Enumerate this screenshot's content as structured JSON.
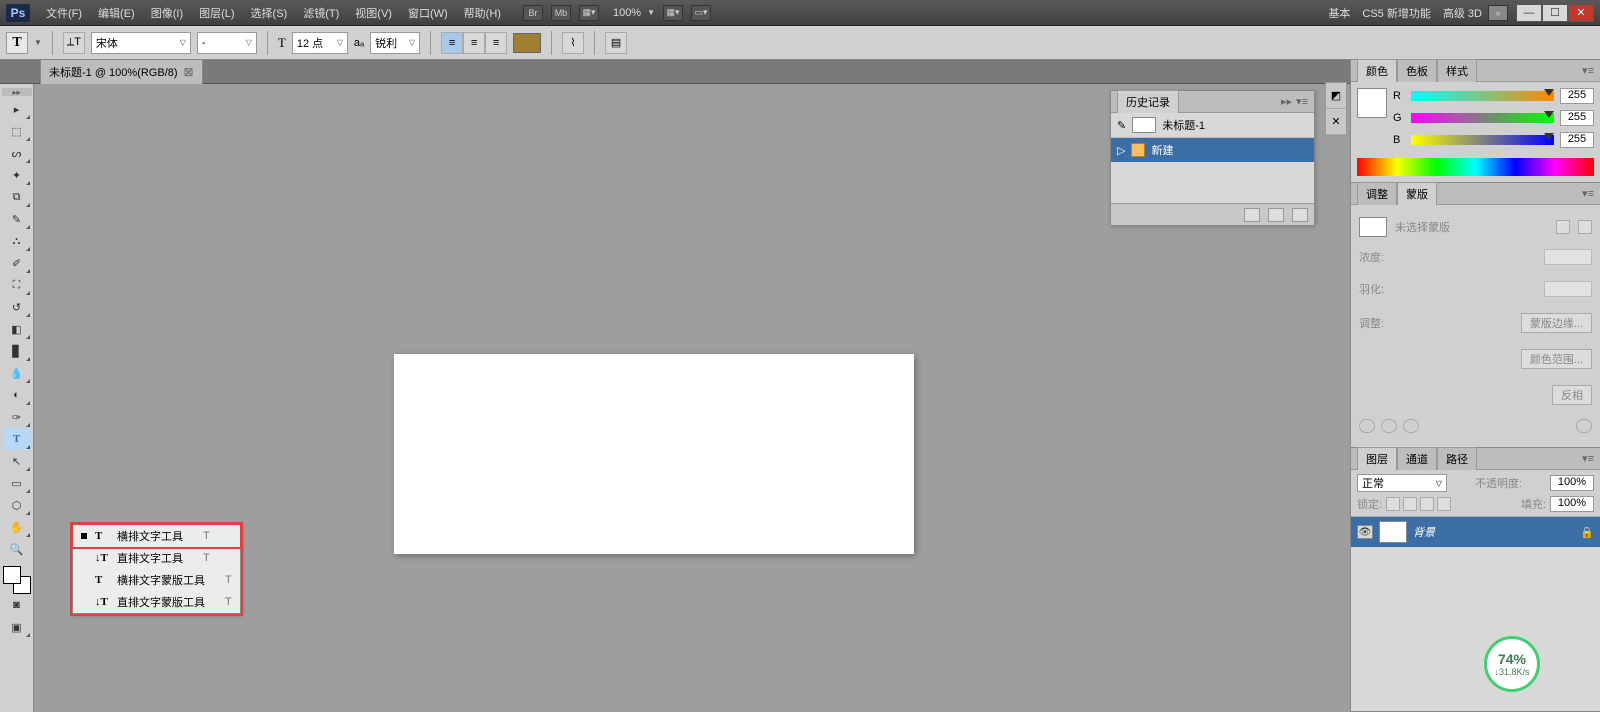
{
  "app_logo": "Ps",
  "menu": {
    "file": "文件(F)",
    "edit": "编辑(E)",
    "image": "图像(I)",
    "layer": "图层(L)",
    "select": "选择(S)",
    "filter": "滤镜(T)",
    "view": "视图(V)",
    "window": "窗口(W)",
    "help": "帮助(H)"
  },
  "topright": {
    "zoom": "100%",
    "basic": "基本",
    "cs5new": "CS5 新增功能",
    "adv3d": "高级 3D"
  },
  "options": {
    "font_family": "宋体",
    "font_style": "-",
    "size_prefix": "T",
    "size": "12 点",
    "aa_prefix": "aₐ",
    "aa": "锐利"
  },
  "doc_tab": "未标题-1 @ 100%(RGB/8)",
  "flyout": {
    "row1": {
      "label": "横排文字工具",
      "key": "T"
    },
    "row2": {
      "label": "直排文字工具",
      "key": "T"
    },
    "row3": {
      "label": "横排文字蒙版工具",
      "key": "T"
    },
    "row4": {
      "label": "直排文字蒙版工具",
      "key": "T"
    }
  },
  "history": {
    "title": "历史记录",
    "doc": "未标题-1",
    "step1": "新建"
  },
  "color_panel": {
    "tab_color": "颜色",
    "tab_swatch": "色板",
    "tab_style": "样式",
    "r": "R",
    "r_val": "255",
    "g": "G",
    "g_val": "255",
    "b": "B",
    "b_val": "255"
  },
  "mask_panel": {
    "tab_adjust": "调整",
    "tab_mask": "蒙版",
    "no_mask": "未选择蒙版",
    "density": "浓度:",
    "feather": "羽化:",
    "refine": "调整:",
    "mask_edge": "蒙版边缘...",
    "color_range": "颜色范围...",
    "invert": "反相"
  },
  "layers_panel": {
    "tab_layers": "图层",
    "tab_channels": "通道",
    "tab_paths": "路径",
    "blend": "正常",
    "opacity_lab": "不透明度:",
    "opacity_val": "100%",
    "lock_lab": "锁定:",
    "fill_lab": "填充:",
    "fill_val": "100%",
    "layer1": "背景"
  },
  "speed": {
    "pct": "74%",
    "rate": "↓31.8K/s"
  }
}
